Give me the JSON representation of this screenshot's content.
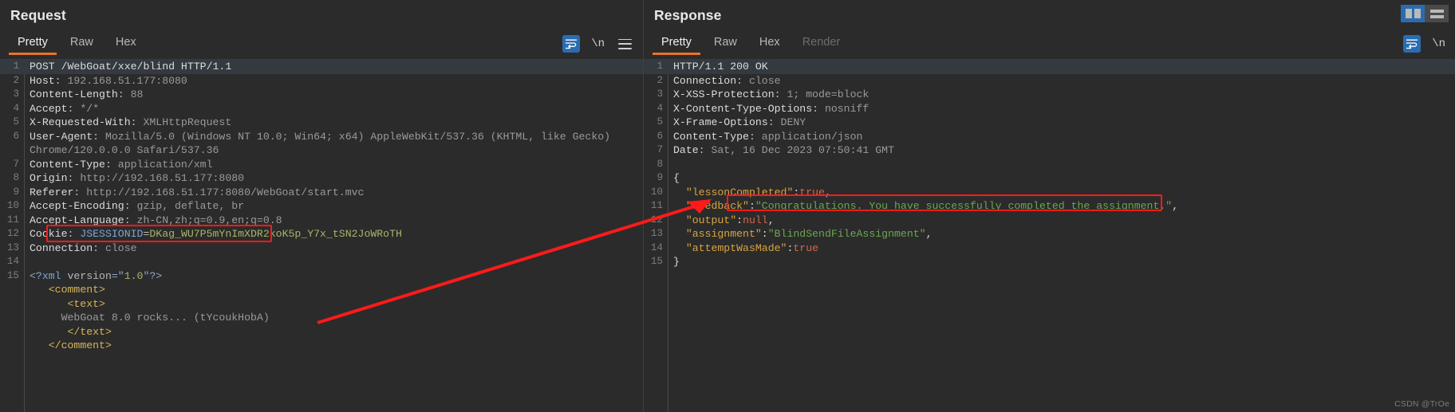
{
  "window": {
    "layout_buttons": [
      {
        "name": "split-vertical",
        "active": true
      },
      {
        "name": "split-horizontal",
        "active": false
      }
    ],
    "watermark": "CSDN @TrOe"
  },
  "request": {
    "title": "Request",
    "tabs": [
      {
        "label": "Pretty",
        "active": true,
        "disabled": false
      },
      {
        "label": "Raw",
        "active": false,
        "disabled": false
      },
      {
        "label": "Hex",
        "active": false,
        "disabled": false
      }
    ],
    "tools": [
      {
        "name": "word-wrap-icon",
        "glyph": "↵",
        "selected": true
      },
      {
        "name": "newline-icon",
        "label": "\\n",
        "selected": false
      },
      {
        "name": "menu-icon",
        "label": "",
        "selected": false
      }
    ],
    "lines": [
      {
        "n": "1",
        "segs": [
          {
            "t": "white",
            "s": "POST /WebGoat/xxe/blind HTTP/1.1"
          }
        ],
        "hl": true
      },
      {
        "n": "2",
        "segs": [
          {
            "t": "white",
            "s": "Host"
          },
          {
            "t": "plain",
            "s": ": "
          },
          {
            "t": "dim",
            "s": "192.168.51.177:8080"
          }
        ]
      },
      {
        "n": "3",
        "segs": [
          {
            "t": "white",
            "s": "Content-Length"
          },
          {
            "t": "plain",
            "s": ": "
          },
          {
            "t": "dim",
            "s": "88"
          }
        ]
      },
      {
        "n": "4",
        "segs": [
          {
            "t": "white",
            "s": "Accept"
          },
          {
            "t": "plain",
            "s": ": "
          },
          {
            "t": "dim",
            "s": "*/*"
          }
        ]
      },
      {
        "n": "5",
        "segs": [
          {
            "t": "white",
            "s": "X-Requested-With"
          },
          {
            "t": "plain",
            "s": ": "
          },
          {
            "t": "dim",
            "s": "XMLHttpRequest"
          }
        ]
      },
      {
        "n": "6",
        "segs": [
          {
            "t": "white",
            "s": "User-Agent"
          },
          {
            "t": "plain",
            "s": ": "
          },
          {
            "t": "dim",
            "s": "Mozilla/5.0 (Windows NT 10.0; Win64; x64) AppleWebKit/537.36 (KHTML, like Gecko)"
          }
        ]
      },
      {
        "n": "",
        "segs": [
          {
            "t": "dim",
            "s": "Chrome/120.0.0.0 Safari/537.36"
          }
        ]
      },
      {
        "n": "7",
        "segs": [
          {
            "t": "white",
            "s": "Content-Type"
          },
          {
            "t": "plain",
            "s": ": "
          },
          {
            "t": "dim",
            "s": "application/xml"
          }
        ]
      },
      {
        "n": "8",
        "segs": [
          {
            "t": "white",
            "s": "Origin"
          },
          {
            "t": "plain",
            "s": ": "
          },
          {
            "t": "dim",
            "s": "http://192.168.51.177:8080"
          }
        ]
      },
      {
        "n": "9",
        "segs": [
          {
            "t": "white",
            "s": "Referer"
          },
          {
            "t": "plain",
            "s": ": "
          },
          {
            "t": "dim",
            "s": "http://192.168.51.177:8080/WebGoat/start.mvc"
          }
        ]
      },
      {
        "n": "10",
        "segs": [
          {
            "t": "white",
            "s": "Accept-Encoding"
          },
          {
            "t": "plain",
            "s": ": "
          },
          {
            "t": "dim",
            "s": "gzip, deflate, br"
          }
        ]
      },
      {
        "n": "11",
        "segs": [
          {
            "t": "white",
            "s": "Accept-Language"
          },
          {
            "t": "plain",
            "s": ": "
          },
          {
            "t": "dim",
            "s": "zh-CN,zh;q=0.9,en;q=0.8"
          }
        ]
      },
      {
        "n": "12",
        "segs": [
          {
            "t": "white",
            "s": "Cookie"
          },
          {
            "t": "plain",
            "s": ": "
          },
          {
            "t": "key",
            "s": "JSESSIONID"
          },
          {
            "t": "plain",
            "s": "="
          },
          {
            "t": "val",
            "s": "DKag_WU7P5mYnImXDR2koK5p_Y7x_tSN2JoWRoTH"
          }
        ]
      },
      {
        "n": "13",
        "segs": [
          {
            "t": "white",
            "s": "Connection"
          },
          {
            "t": "plain",
            "s": ": "
          },
          {
            "t": "dim",
            "s": "close"
          }
        ]
      },
      {
        "n": "14",
        "segs": [
          {
            "t": "plain",
            "s": ""
          }
        ]
      },
      {
        "n": "15",
        "segs": [
          {
            "t": "punct",
            "s": "<?"
          },
          {
            "t": "key",
            "s": "xml "
          },
          {
            "t": "attr",
            "s": "version"
          },
          {
            "t": "punct",
            "s": "=\""
          },
          {
            "t": "num",
            "s": "1.0"
          },
          {
            "t": "punct",
            "s": "\"?>"
          }
        ]
      },
      {
        "n": "",
        "segs": [
          {
            "t": "plain",
            "s": "   "
          },
          {
            "t": "tag",
            "s": "<comment>"
          }
        ]
      },
      {
        "n": "",
        "segs": [
          {
            "t": "plain",
            "s": "      "
          },
          {
            "t": "tag",
            "s": "<text>"
          }
        ]
      },
      {
        "n": "",
        "segs": [
          {
            "t": "plain",
            "s": "     "
          },
          {
            "t": "dim",
            "s": "WebGoat 8.0 rocks... (tYcoukHobA)"
          }
        ]
      },
      {
        "n": "",
        "segs": [
          {
            "t": "plain",
            "s": "      "
          },
          {
            "t": "tag",
            "s": "</text>"
          }
        ]
      },
      {
        "n": "",
        "segs": [
          {
            "t": "plain",
            "s": "   "
          },
          {
            "t": "tag",
            "s": "</comment>"
          }
        ]
      }
    ],
    "annotation": {
      "name": "xxe-payload-highlight",
      "text": "WebGoat 8.0 rocks... (tYcoukHobA)"
    }
  },
  "response": {
    "title": "Response",
    "tabs": [
      {
        "label": "Pretty",
        "active": true,
        "disabled": false
      },
      {
        "label": "Raw",
        "active": false,
        "disabled": false
      },
      {
        "label": "Hex",
        "active": false,
        "disabled": false
      },
      {
        "label": "Render",
        "active": false,
        "disabled": true
      }
    ],
    "tools": [
      {
        "name": "word-wrap-icon",
        "glyph": "↵",
        "selected": true
      },
      {
        "name": "newline-icon",
        "label": "\\n",
        "selected": false
      }
    ],
    "lines": [
      {
        "n": "1",
        "segs": [
          {
            "t": "white",
            "s": "HTTP/1.1 200 OK"
          }
        ],
        "hl": true
      },
      {
        "n": "2",
        "segs": [
          {
            "t": "white",
            "s": "Connection"
          },
          {
            "t": "plain",
            "s": ": "
          },
          {
            "t": "dim",
            "s": "close"
          }
        ]
      },
      {
        "n": "3",
        "segs": [
          {
            "t": "white",
            "s": "X-XSS-Protection"
          },
          {
            "t": "plain",
            "s": ": "
          },
          {
            "t": "dim",
            "s": "1; mode=block"
          }
        ]
      },
      {
        "n": "4",
        "segs": [
          {
            "t": "white",
            "s": "X-Content-Type-Options"
          },
          {
            "t": "plain",
            "s": ": "
          },
          {
            "t": "dim",
            "s": "nosniff"
          }
        ]
      },
      {
        "n": "5",
        "segs": [
          {
            "t": "white",
            "s": "X-Frame-Options"
          },
          {
            "t": "plain",
            "s": ": "
          },
          {
            "t": "dim",
            "s": "DENY"
          }
        ]
      },
      {
        "n": "6",
        "segs": [
          {
            "t": "white",
            "s": "Content-Type"
          },
          {
            "t": "plain",
            "s": ": "
          },
          {
            "t": "dim",
            "s": "application/json"
          }
        ]
      },
      {
        "n": "7",
        "segs": [
          {
            "t": "white",
            "s": "Date"
          },
          {
            "t": "plain",
            "s": ": "
          },
          {
            "t": "dim",
            "s": "Sat, 16 Dec 2023 07:50:41 GMT"
          }
        ]
      },
      {
        "n": "8",
        "segs": [
          {
            "t": "plain",
            "s": ""
          }
        ]
      },
      {
        "n": "9",
        "segs": [
          {
            "t": "white",
            "s": "{"
          }
        ]
      },
      {
        "n": "10",
        "segs": [
          {
            "t": "plain",
            "s": "  "
          },
          {
            "t": "jkey",
            "s": "\"lessonCompleted\""
          },
          {
            "t": "white",
            "s": ":"
          },
          {
            "t": "jlit",
            "s": "true"
          },
          {
            "t": "white",
            "s": ","
          }
        ]
      },
      {
        "n": "11",
        "segs": [
          {
            "t": "plain",
            "s": "  "
          },
          {
            "t": "jkey",
            "s": "\"feedback\""
          },
          {
            "t": "white",
            "s": ":"
          },
          {
            "t": "str",
            "s": "\"Congratulations. You have successfully completed the assignment.\""
          },
          {
            "t": "white",
            "s": ","
          }
        ]
      },
      {
        "n": "12",
        "segs": [
          {
            "t": "plain",
            "s": "  "
          },
          {
            "t": "jkey",
            "s": "\"output\""
          },
          {
            "t": "white",
            "s": ":"
          },
          {
            "t": "jlit",
            "s": "null"
          },
          {
            "t": "white",
            "s": ","
          }
        ]
      },
      {
        "n": "13",
        "segs": [
          {
            "t": "plain",
            "s": "  "
          },
          {
            "t": "jkey",
            "s": "\"assignment\""
          },
          {
            "t": "white",
            "s": ":"
          },
          {
            "t": "str",
            "s": "\"BlindSendFileAssignment\""
          },
          {
            "t": "white",
            "s": ","
          }
        ]
      },
      {
        "n": "14",
        "segs": [
          {
            "t": "plain",
            "s": "  "
          },
          {
            "t": "jkey",
            "s": "\"attemptWasMade\""
          },
          {
            "t": "white",
            "s": ":"
          },
          {
            "t": "jlit",
            "s": "true"
          }
        ]
      },
      {
        "n": "15",
        "segs": [
          {
            "t": "white",
            "s": "}"
          }
        ]
      }
    ],
    "annotation": {
      "name": "feedback-highlight",
      "text": "\"Congratulations. You have successfully completed the assignment.\","
    }
  },
  "colors": {
    "accent": "#e8732c",
    "annotation": "#ff1a1a",
    "selection": "#2b6cb0",
    "background": "#2b2b2b"
  }
}
